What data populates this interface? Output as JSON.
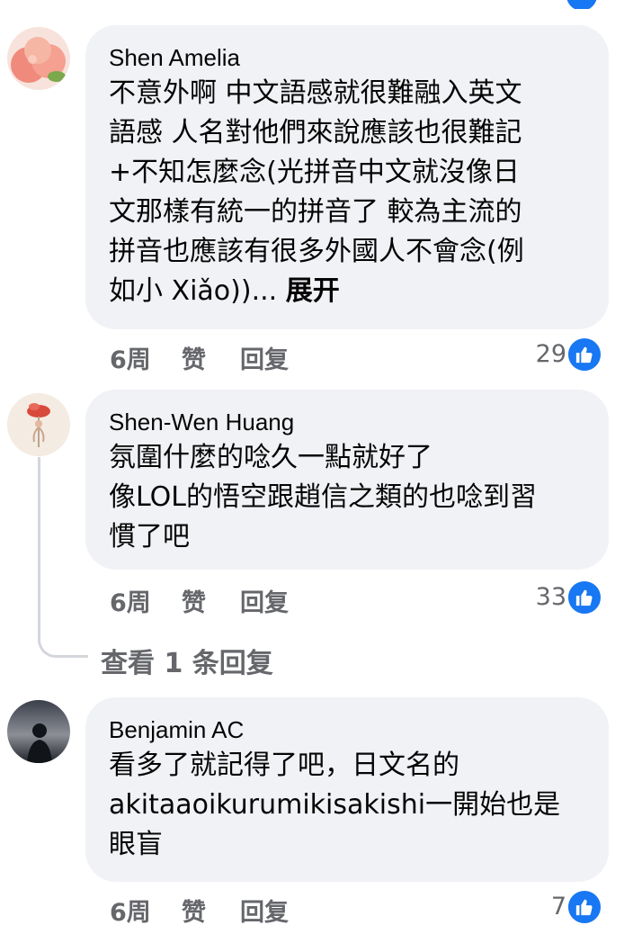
{
  "comments": [
    {
      "author": "Shen Amelia",
      "lines": [
        "不意外啊 中文語感就很難融入英文",
        "語感 人名對他們來說應該也很難記",
        "+不知怎麼念(光拼音中文就沒像日",
        "文那樣有統一的拼音了 較為主流的",
        "拼音也應該有很多外國人不會念(例",
        "如小 Xiǎo))..."
      ],
      "see_more": "展开",
      "time": "6周",
      "like_label": "赞",
      "reply_label": "回复",
      "reaction_count": "29",
      "avatar": "peach-avatar"
    },
    {
      "author": "Shen-Wen Huang",
      "lines": [
        "氛圍什麼的唸久一點就好了",
        "像LOL的悟空跟趙信之類的也唸到習",
        "慣了吧"
      ],
      "time": "6周",
      "like_label": "赞",
      "reply_label": "回复",
      "reaction_count": "33",
      "avatar": "flower-avatar"
    },
    {
      "author": "Benjamin AC",
      "lines": [
        "看多了就記得了吧，日文名的",
        "akitaaoikurumikisakishi一開始也是",
        "眼盲"
      ],
      "time": "6周",
      "like_label": "赞",
      "reply_label": "回复",
      "reaction_count": "7",
      "avatar": "silhouette-avatar"
    }
  ],
  "view_replies": "查看 1 条回复",
  "colors": {
    "bubble_bg": "#f0f2f5",
    "secondary_text": "#65676b",
    "like_blue": "#1877f2"
  }
}
